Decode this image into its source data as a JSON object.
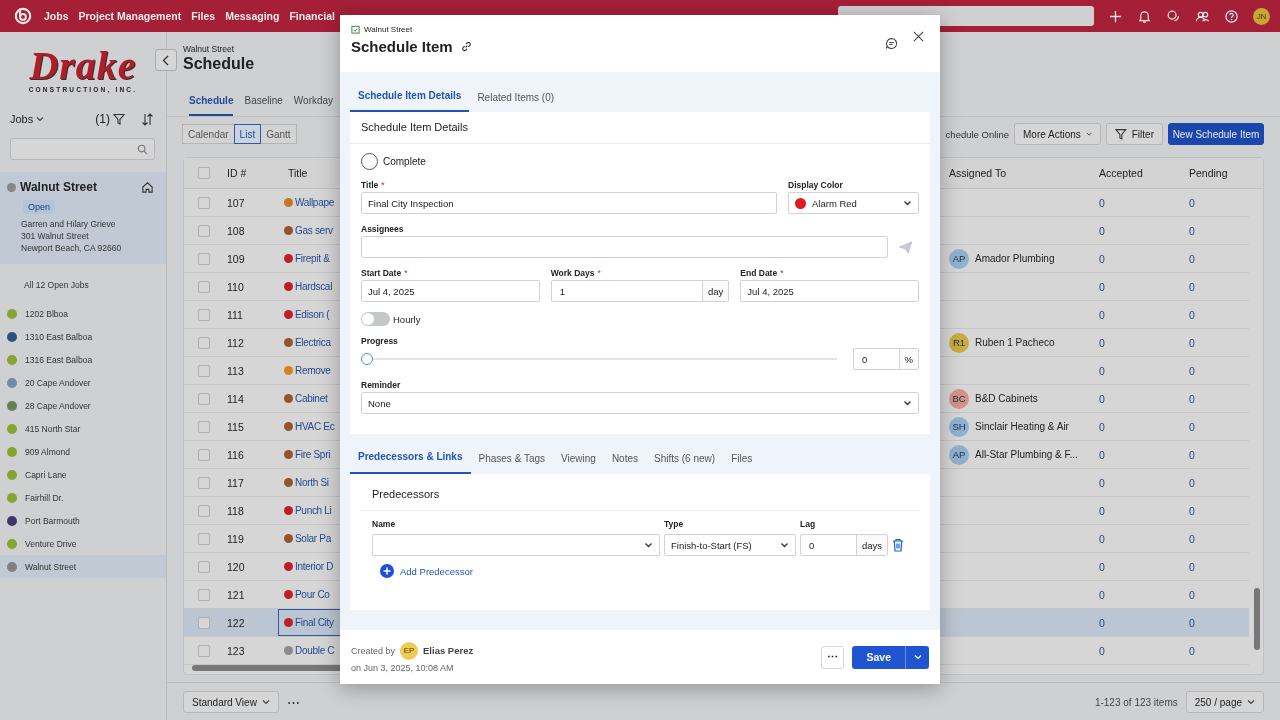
{
  "top_bar": {
    "nav": [
      "Jobs",
      "Project Management",
      "Files",
      "Messaging",
      "Financial"
    ],
    "avatar": "JN"
  },
  "sidebar": {
    "logo": {
      "name": "Drake",
      "tagline": "CONSTRUCTION, INC."
    },
    "jobs_menu": "Jobs",
    "filter_count": "(1)",
    "current_job": {
      "name": "Walnut Street",
      "status": "Open",
      "address": [
        "Garren and Hilary Grieve",
        "301 Walnut Street",
        "Newport Beach, CA 92660"
      ]
    },
    "all_jobs": "All 12 Open Jobs",
    "jobs": [
      {
        "name": "1202 Blboa",
        "color": "#86a530",
        "selected": false
      },
      {
        "name": "1310 East Balboa",
        "color": "#2a547e",
        "selected": false
      },
      {
        "name": "1316 East Balboa",
        "color": "#86a530",
        "selected": false
      },
      {
        "name": "20 Cape Andover",
        "color": "#6f8cab",
        "selected": false
      },
      {
        "name": "28 Cape Andover",
        "color": "#667f53",
        "selected": false
      },
      {
        "name": "415 North Star",
        "color": "#86a530",
        "selected": false
      },
      {
        "name": "909 Almond",
        "color": "#86a530",
        "selected": false
      },
      {
        "name": "Capri Lane",
        "color": "#86a530",
        "selected": false
      },
      {
        "name": "Fairhill Dr.",
        "color": "#86a530",
        "selected": false
      },
      {
        "name": "Port Barmouth",
        "color": "#42356f",
        "selected": false
      },
      {
        "name": "Venture Drive",
        "color": "#86a530",
        "selected": false
      },
      {
        "name": "Walnut Street",
        "color": "#808080",
        "selected": true
      }
    ]
  },
  "page": {
    "breadcrumb": "Walnut Street",
    "title": "Schedule",
    "tabs": [
      {
        "label": "Schedule",
        "selected": true
      },
      {
        "label": "Baseline",
        "selected": false
      },
      {
        "label": "Workday",
        "selected": false
      }
    ],
    "views": [
      {
        "label": "Calendar",
        "selected": false
      },
      {
        "label": "List",
        "selected": true
      },
      {
        "label": "Gantt",
        "selected": false
      }
    ],
    "actions": [
      {
        "kind": "link",
        "label": "chedule Online"
      },
      {
        "kind": "menu",
        "label": "More Actions"
      },
      {
        "kind": "filter",
        "label": "Filter"
      },
      {
        "kind": "primary",
        "label": "New Schedule Item"
      }
    ]
  },
  "table": {
    "columns": [
      "ID #",
      "Title",
      "Assigned To",
      "Accepted",
      "Pending"
    ],
    "select_all_checked": false,
    "rows": [
      {
        "id": "107",
        "title": "Wallpape",
        "color": "#c67428",
        "accepted": "0",
        "pending": "0",
        "checked": false,
        "selected": false
      },
      {
        "id": "108",
        "title": "Gas serv",
        "color": "#94542a",
        "accepted": "0",
        "pending": "0",
        "checked": false,
        "selected": false
      },
      {
        "id": "109",
        "title": "Firepit &",
        "color": "#be1f26",
        "assignee": {
          "initials": "AP",
          "name": "Amador Plumbing",
          "color": "#8fb1cf"
        },
        "accepted": "0",
        "pending": "0",
        "checked": false,
        "selected": false
      },
      {
        "id": "110",
        "title": "Hardscal",
        "color": "#be1f26",
        "accepted": "0",
        "pending": "0",
        "checked": false,
        "selected": false
      },
      {
        "id": "111",
        "title": "Edison (",
        "color": "#be1f26",
        "accepted": "0",
        "pending": "0",
        "checked": false,
        "selected": false
      },
      {
        "id": "112",
        "title": "Electrica",
        "color": "#94542a",
        "assignee": {
          "initials": "R1",
          "name": "Ruben 1 Pacheco",
          "color": "#c8ac40"
        },
        "accepted": "0",
        "pending": "0",
        "checked": false,
        "selected": false
      },
      {
        "id": "113",
        "title": "Remove",
        "color": "#d38519",
        "accepted": "0",
        "pending": "0",
        "checked": false,
        "selected": false
      },
      {
        "id": "114",
        "title": "Cabinet",
        "color": "#94542a",
        "assignee": {
          "initials": "BC",
          "name": "B&D Cabinets",
          "color": "#d29489"
        },
        "accepted": "0",
        "pending": "0",
        "checked": false,
        "selected": false
      },
      {
        "id": "115",
        "title": "HVAC Ec",
        "color": "#94542a",
        "assignee": {
          "initials": "SH",
          "name": "Sinclair Heating & Air",
          "color": "#8fb1cf"
        },
        "accepted": "0",
        "pending": "0",
        "checked": false,
        "selected": false
      },
      {
        "id": "116",
        "title": "Fire Spri",
        "color": "#94542a",
        "assignee": {
          "initials": "AP",
          "name": "All-Star Plumbing & F...",
          "color": "#8fb1cf"
        },
        "accepted": "0",
        "pending": "0",
        "checked": false,
        "selected": false
      },
      {
        "id": "117",
        "title": "North Si",
        "color": "#94542a",
        "accepted": "0",
        "pending": "0",
        "checked": false,
        "selected": false
      },
      {
        "id": "118",
        "title": "Punch Li",
        "color": "#be1f26",
        "accepted": "0",
        "pending": "0",
        "checked": false,
        "selected": false
      },
      {
        "id": "119",
        "title": "Solar Pa",
        "color": "#94542a",
        "accepted": "0",
        "pending": "0",
        "checked": false,
        "selected": false
      },
      {
        "id": "120",
        "title": "Interior D",
        "color": "#be1f26",
        "accepted": "0",
        "pending": "0",
        "checked": false,
        "selected": false
      },
      {
        "id": "121",
        "title": "Pour Co",
        "color": "#be1f26",
        "accepted": "0",
        "pending": "0",
        "checked": false,
        "selected": false
      },
      {
        "id": "122",
        "title": "Final City",
        "color": "#be1f26",
        "accepted": "0",
        "pending": "0",
        "checked": false,
        "selected": true
      },
      {
        "id": "123",
        "title": "Double C",
        "color": "#8a8a8a",
        "accepted": "0",
        "pending": "0",
        "checked": false,
        "selected": false
      }
    ]
  },
  "footer": {
    "view": "Standard View",
    "more": "⋯",
    "count": "1-123 of 123 items",
    "page_size": "250 / page"
  },
  "modal": {
    "breadcrumb": "Walnut Street",
    "title": "Schedule Item",
    "tabs": [
      {
        "label": "Schedule Item Details",
        "selected": true
      },
      {
        "label": "Related Items (0)",
        "selected": false
      }
    ],
    "details": {
      "heading": "Schedule Item Details",
      "complete": {
        "label": "Complete",
        "checked": false
      },
      "title": {
        "label": "Title",
        "required_mark": "*",
        "value": "Final City Inspection"
      },
      "display_color": {
        "label": "Display Color",
        "value": "Alarm Red",
        "color": "#dd1c1c"
      },
      "assignees": {
        "label": "Assignees"
      },
      "start_date": {
        "label": "Start Date",
        "required_mark": "*",
        "value": "Jul 4, 2025"
      },
      "work_days": {
        "label": "Work Days",
        "required_mark": "*",
        "value": "1",
        "unit": "day"
      },
      "end_date": {
        "label": "End Date",
        "required_mark": "*",
        "value": "Jul 4, 2025"
      },
      "hourly": {
        "label": "Hourly",
        "on": false
      },
      "progress": {
        "label": "Progress",
        "level": 0,
        "value": "0",
        "unit": "%"
      },
      "reminder": {
        "label": "Reminder",
        "value": "None"
      }
    },
    "lower_tabs": [
      {
        "label": "Predecessors & Links",
        "selected": true
      },
      {
        "label": "Phases & Tags",
        "selected": false
      },
      {
        "label": "Viewing",
        "selected": false
      },
      {
        "label": "Notes",
        "selected": false
      },
      {
        "label": "Shifts (6 new)",
        "selected": false
      },
      {
        "label": "Files",
        "selected": false
      }
    ],
    "predecessors": {
      "heading": "Predecessors",
      "columns": [
        "Name",
        "Type",
        "Lag"
      ],
      "rows": [
        {
          "type": "Finish-to-Start (FS)",
          "lag": "0",
          "unit": "days"
        }
      ],
      "add_label": "Add Predecessor"
    },
    "footer": {
      "created_label": "Created by",
      "author": {
        "initials": "EP",
        "name": "Elias Perez"
      },
      "date": "on Jun 3, 2025, 10:08 AM",
      "more": "⋯",
      "save": "Save"
    }
  }
}
